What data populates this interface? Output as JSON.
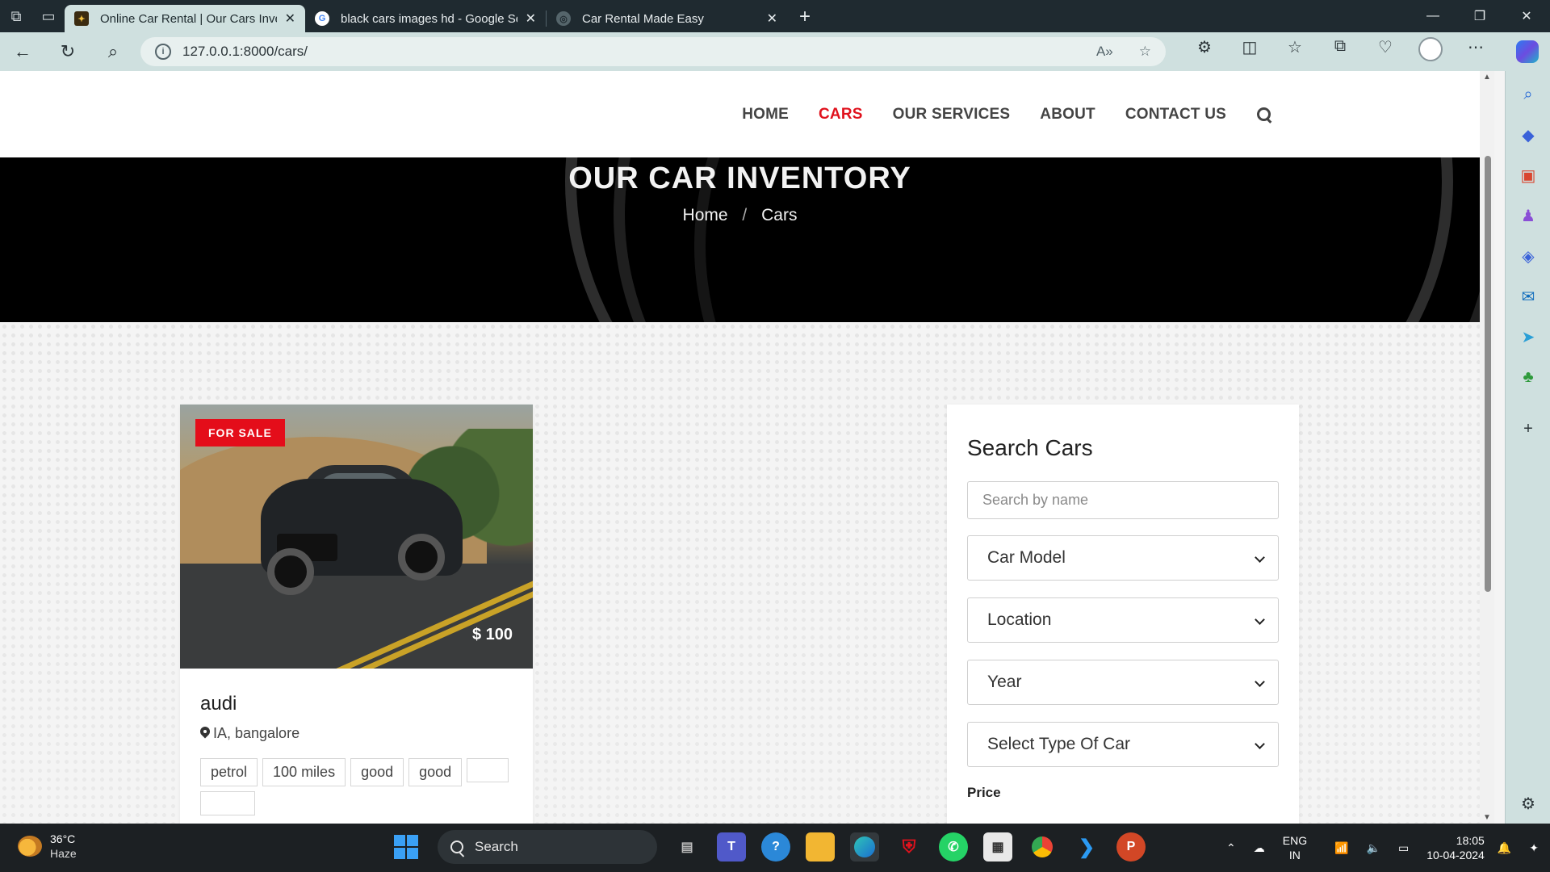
{
  "browser": {
    "tabs": [
      {
        "title": "Online Car Rental | Our Cars Inventory",
        "active": true
      },
      {
        "title": "black cars images hd - Google Search",
        "active": false
      },
      {
        "title": "Car Rental Made Easy",
        "active": false
      }
    ],
    "url": "127.0.0.1:8000/cars/"
  },
  "nav": {
    "items": [
      "HOME",
      "CARS",
      "OUR SERVICES",
      "ABOUT",
      "CONTACT US"
    ],
    "active": "CARS"
  },
  "hero": {
    "title": "OUR CAR INVENTORY",
    "breadcrumb_home": "Home",
    "breadcrumb_sep": "/",
    "breadcrumb_current": "Cars"
  },
  "car": {
    "badge": "FOR SALE",
    "price": "$ 100",
    "name": "audi",
    "location": "IA, bangalore",
    "tags": [
      "petrol",
      "100 miles",
      "good",
      "good"
    ]
  },
  "search": {
    "title": "Search Cars",
    "placeholder": "Search by name",
    "model": "Car Model",
    "location": "Location",
    "year": "Year",
    "type": "Select Type Of Car",
    "price_label": "Price"
  },
  "taskbar": {
    "temp": "36°C",
    "condition": "Haze",
    "search": "Search",
    "lang1": "ENG",
    "lang2": "IN",
    "time": "18:05",
    "date": "10-04-2024"
  },
  "colors": {
    "accent_red": "#e0121d",
    "badge_red": "#e40d1a",
    "chrome": "#cfe0df"
  }
}
